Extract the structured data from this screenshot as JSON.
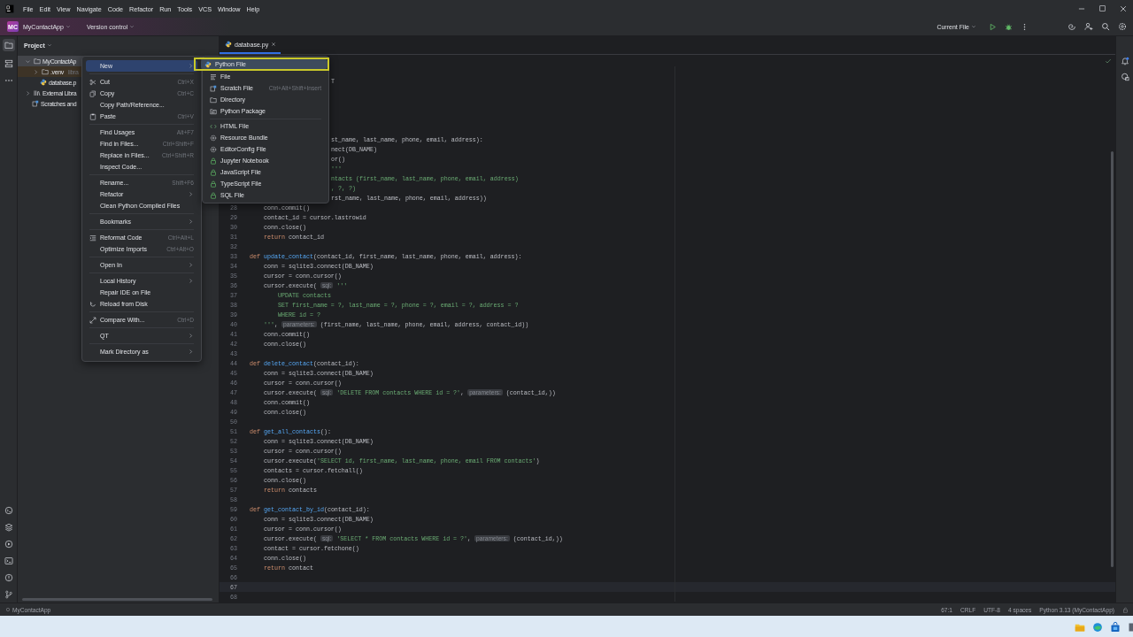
{
  "menu_bar": [
    "File",
    "Edit",
    "View",
    "Navigate",
    "Code",
    "Refactor",
    "Run",
    "Tools",
    "VCS",
    "Window",
    "Help"
  ],
  "toolbar": {
    "project_badge": "MC",
    "project": "MyContactApp",
    "vcs": "Version control",
    "run_config": "Current File"
  },
  "project_panel": {
    "title": "Project",
    "tree": [
      {
        "label": "MyContactAp",
        "kind": "folder",
        "expanded": true,
        "selected": true,
        "excluded": false,
        "children": [
          {
            "label": ".venv",
            "hint": "libra",
            "kind": "folder",
            "expanded": false,
            "selected": false,
            "excluded": true
          },
          {
            "label": "database.p",
            "kind": "python-file",
            "selected": false,
            "excluded": false
          }
        ]
      },
      {
        "label": "External Libra",
        "kind": "libraries",
        "expanded": false,
        "selected": false,
        "excluded": false
      },
      {
        "label": "Scratches and",
        "kind": "scratches",
        "selected": false,
        "excluded": false
      }
    ]
  },
  "editor": {
    "tabs": [
      {
        "label": "database.py",
        "selected": true
      }
    ],
    "lines": [
      {
        "current": false
      },
      {
        "current": false,
        "tokens": [
          {
            "kind": "plain",
            "text": "T"
          }
        ]
      },
      {
        "current": false
      },
      {
        "current": false
      },
      {
        "current": false
      },
      {
        "current": false
      },
      {
        "current": false
      },
      {
        "current": false,
        "tokens": [
          {
            "kind": "plain",
            "text": "st_name, last_name, phone, email, address):"
          }
        ]
      },
      {
        "current": false,
        "tokens": [
          {
            "kind": "plain",
            "text": "nect(DB_NAME)"
          }
        ]
      },
      {
        "current": false,
        "tokens": [
          {
            "kind": "plain",
            "text": "or()"
          }
        ]
      },
      {
        "current": false,
        "tokens": [
          {
            "kind": "string",
            "text": "'''"
          }
        ]
      },
      {
        "current": false,
        "tokens": [
          {
            "kind": "string",
            "text": "ntacts (first_name, last_name, phone, email, address)"
          }
        ]
      },
      {
        "current": false,
        "tokens": [
          {
            "kind": "string",
            "text": ", ?, ?)"
          }
        ]
      },
      {
        "current": false,
        "tokens": [
          {
            "kind": "plain",
            "text": "rst_name, last_name, phone, email, address))"
          }
        ]
      },
      {
        "number": "28",
        "current": false,
        "tokens": [
          {
            "kind": "plain",
            "text": "    conn.commit()"
          }
        ]
      },
      {
        "number": "29",
        "current": false,
        "tokens": [
          {
            "kind": "plain",
            "text": "    contact_id = cursor.lastrowid"
          }
        ]
      },
      {
        "number": "30",
        "current": false,
        "tokens": [
          {
            "kind": "plain",
            "text": "    conn.close()"
          }
        ]
      },
      {
        "number": "31",
        "current": false,
        "tokens": [
          {
            "kind": "keyword",
            "text": "    return"
          },
          {
            "kind": "plain",
            "text": " contact_id"
          }
        ]
      },
      {
        "number": "32",
        "current": false
      },
      {
        "number": "33",
        "current": false,
        "tokens": [
          {
            "kind": "keyword",
            "text": "def "
          },
          {
            "kind": "function",
            "text": "update_contact"
          },
          {
            "kind": "plain",
            "text": "(contact_id, first_name, last_name, phone, email, address):"
          }
        ]
      },
      {
        "number": "34",
        "current": false,
        "tokens": [
          {
            "kind": "plain",
            "text": "    conn = sqlite3.connect(DB_NAME)"
          }
        ]
      },
      {
        "number": "35",
        "current": false,
        "tokens": [
          {
            "kind": "plain",
            "text": "    cursor = conn.cursor()"
          }
        ]
      },
      {
        "number": "36",
        "current": false,
        "tokens": [
          {
            "kind": "plain",
            "text": "    cursor.execute( "
          },
          {
            "kind": "hint",
            "text": "sql:"
          },
          {
            "kind": "string",
            "text": " '''"
          }
        ]
      },
      {
        "number": "37",
        "current": false,
        "tokens": [
          {
            "kind": "string",
            "text": "        UPDATE contacts"
          }
        ]
      },
      {
        "number": "38",
        "current": false,
        "tokens": [
          {
            "kind": "string",
            "text": "        SET first_name = ?, last_name = ?, phone = ?, email = ?, address = ?"
          }
        ]
      },
      {
        "number": "39",
        "current": false,
        "tokens": [
          {
            "kind": "string",
            "text": "        WHERE id = ?"
          }
        ]
      },
      {
        "number": "40",
        "current": false,
        "tokens": [
          {
            "kind": "string",
            "text": "    '''"
          },
          {
            "kind": "plain",
            "text": ", "
          },
          {
            "kind": "hint",
            "text": "parameters:"
          },
          {
            "kind": "plain",
            "text": " (first_name, last_name, phone, email, address, contact_id))"
          }
        ]
      },
      {
        "number": "41",
        "current": false,
        "tokens": [
          {
            "kind": "plain",
            "text": "    conn.commit()"
          }
        ]
      },
      {
        "number": "42",
        "current": false,
        "tokens": [
          {
            "kind": "plain",
            "text": "    conn.close()"
          }
        ]
      },
      {
        "number": "43",
        "current": false
      },
      {
        "number": "44",
        "current": false,
        "tokens": [
          {
            "kind": "keyword",
            "text": "def "
          },
          {
            "kind": "function",
            "text": "delete_contact"
          },
          {
            "kind": "plain",
            "text": "(contact_id):"
          }
        ]
      },
      {
        "number": "45",
        "current": false,
        "tokens": [
          {
            "kind": "plain",
            "text": "    conn = sqlite3.connect(DB_NAME)"
          }
        ]
      },
      {
        "number": "46",
        "current": false,
        "tokens": [
          {
            "kind": "plain",
            "text": "    cursor = conn.cursor()"
          }
        ]
      },
      {
        "number": "47",
        "current": false,
        "tokens": [
          {
            "kind": "plain",
            "text": "    cursor.execute( "
          },
          {
            "kind": "hint",
            "text": "sql:"
          },
          {
            "kind": "string",
            "text": " 'DELETE FROM contacts WHERE id = ?'"
          },
          {
            "kind": "plain",
            "text": ", "
          },
          {
            "kind": "hint",
            "text": "parameters:"
          },
          {
            "kind": "plain",
            "text": " (contact_id,))"
          }
        ]
      },
      {
        "number": "48",
        "current": false,
        "tokens": [
          {
            "kind": "plain",
            "text": "    conn.commit()"
          }
        ]
      },
      {
        "number": "49",
        "current": false,
        "tokens": [
          {
            "kind": "plain",
            "text": "    conn.close()"
          }
        ]
      },
      {
        "number": "50",
        "current": false
      },
      {
        "number": "51",
        "current": false,
        "tokens": [
          {
            "kind": "keyword",
            "text": "def "
          },
          {
            "kind": "function",
            "text": "get_all_contacts"
          },
          {
            "kind": "plain",
            "text": "():"
          }
        ]
      },
      {
        "number": "52",
        "current": false,
        "tokens": [
          {
            "kind": "plain",
            "text": "    conn = sqlite3.connect(DB_NAME)"
          }
        ]
      },
      {
        "number": "53",
        "current": false,
        "tokens": [
          {
            "kind": "plain",
            "text": "    cursor = conn.cursor()"
          }
        ]
      },
      {
        "number": "54",
        "current": false,
        "tokens": [
          {
            "kind": "plain",
            "text": "    cursor.execute("
          },
          {
            "kind": "string",
            "text": "'SELECT id, first_name, last_name, phone, email FROM contacts'"
          },
          {
            "kind": "plain",
            "text": ")"
          }
        ]
      },
      {
        "number": "55",
        "current": false,
        "tokens": [
          {
            "kind": "plain",
            "text": "    contacts = cursor.fetchall()"
          }
        ]
      },
      {
        "number": "56",
        "current": false,
        "tokens": [
          {
            "kind": "plain",
            "text": "    conn.close()"
          }
        ]
      },
      {
        "number": "57",
        "current": false,
        "tokens": [
          {
            "kind": "keyword",
            "text": "    return"
          },
          {
            "kind": "plain",
            "text": " contacts"
          }
        ]
      },
      {
        "number": "58",
        "current": false
      },
      {
        "number": "59",
        "current": false,
        "tokens": [
          {
            "kind": "keyword",
            "text": "def "
          },
          {
            "kind": "function",
            "text": "get_contact_by_id"
          },
          {
            "kind": "plain",
            "text": "(contact_id):"
          }
        ]
      },
      {
        "number": "60",
        "current": false,
        "tokens": [
          {
            "kind": "plain",
            "text": "    conn = sqlite3.connect(DB_NAME)"
          }
        ]
      },
      {
        "number": "61",
        "current": false,
        "tokens": [
          {
            "kind": "plain",
            "text": "    cursor = conn.cursor()"
          }
        ]
      },
      {
        "number": "62",
        "current": false,
        "tokens": [
          {
            "kind": "plain",
            "text": "    cursor.execute( "
          },
          {
            "kind": "hint",
            "text": "sql:"
          },
          {
            "kind": "string",
            "text": " 'SELECT * FROM contacts WHERE id = ?'"
          },
          {
            "kind": "plain",
            "text": ", "
          },
          {
            "kind": "hint",
            "text": "parameters:"
          },
          {
            "kind": "plain",
            "text": " (contact_id,))"
          }
        ]
      },
      {
        "number": "63",
        "current": false,
        "tokens": [
          {
            "kind": "plain",
            "text": "    contact = cursor.fetchone()"
          }
        ]
      },
      {
        "number": "64",
        "current": false,
        "tokens": [
          {
            "kind": "plain",
            "text": "    conn.close()"
          }
        ]
      },
      {
        "number": "65",
        "current": false,
        "tokens": [
          {
            "kind": "keyword",
            "text": "    return"
          },
          {
            "kind": "plain",
            "text": " contact"
          }
        ]
      },
      {
        "number": "66",
        "current": false
      },
      {
        "number": "67",
        "current": true
      },
      {
        "number": "68",
        "current": false
      }
    ]
  },
  "context_menu": {
    "items": [
      {
        "kind": "item",
        "label": "New",
        "selected": true,
        "submenu": true
      },
      {
        "kind": "separator"
      },
      {
        "kind": "item",
        "label": "Cut",
        "shortcut": "Ctrl+X",
        "selected": false,
        "submenu": false
      },
      {
        "kind": "item",
        "label": "Copy",
        "shortcut": "Ctrl+C",
        "selected": false,
        "submenu": false
      },
      {
        "kind": "item",
        "label": "Copy Path/Reference...",
        "selected": false,
        "submenu": false
      },
      {
        "kind": "item",
        "label": "Paste",
        "shortcut": "Ctrl+V",
        "selected": false,
        "submenu": false
      },
      {
        "kind": "separator"
      },
      {
        "kind": "item",
        "label": "Find Usages",
        "shortcut": "Alt+F7",
        "selected": false,
        "submenu": false
      },
      {
        "kind": "item",
        "label": "Find in Files...",
        "shortcut": "Ctrl+Shift+F",
        "selected": false,
        "submenu": false
      },
      {
        "kind": "item",
        "label": "Replace in Files...",
        "shortcut": "Ctrl+Shift+R",
        "selected": false,
        "submenu": false
      },
      {
        "kind": "item",
        "label": "Inspect Code...",
        "selected": false,
        "submenu": false
      },
      {
        "kind": "separator"
      },
      {
        "kind": "item",
        "label": "Rename...",
        "shortcut": "Shift+F6",
        "selected": false,
        "submenu": false
      },
      {
        "kind": "item",
        "label": "Refactor",
        "selected": false,
        "submenu": true
      },
      {
        "kind": "item",
        "label": "Clean Python Compiled Files",
        "selected": false,
        "submenu": false
      },
      {
        "kind": "separator"
      },
      {
        "kind": "item",
        "label": "Bookmarks",
        "selected": false,
        "submenu": true
      },
      {
        "kind": "separator"
      },
      {
        "kind": "item",
        "label": "Reformat Code",
        "shortcut": "Ctrl+Alt+L",
        "selected": false,
        "submenu": false
      },
      {
        "kind": "item",
        "label": "Optimize Imports",
        "shortcut": "Ctrl+Alt+O",
        "selected": false,
        "submenu": false
      },
      {
        "kind": "separator"
      },
      {
        "kind": "item",
        "label": "Open In",
        "selected": false,
        "submenu": true
      },
      {
        "kind": "separator"
      },
      {
        "kind": "item",
        "label": "Local History",
        "selected": false,
        "submenu": true
      },
      {
        "kind": "item",
        "label": "Repair IDE on File",
        "selected": false,
        "submenu": false
      },
      {
        "kind": "item",
        "label": "Reload from Disk",
        "selected": false,
        "submenu": false
      },
      {
        "kind": "separator"
      },
      {
        "kind": "item",
        "label": "Compare With...",
        "shortcut": "Ctrl+D",
        "selected": false,
        "submenu": false
      },
      {
        "kind": "separator"
      },
      {
        "kind": "item",
        "label": "QT",
        "selected": false,
        "submenu": true
      },
      {
        "kind": "separator"
      },
      {
        "kind": "item",
        "label": "Mark Directory as",
        "selected": false,
        "submenu": true
      }
    ]
  },
  "new_submenu": {
    "items": [
      {
        "kind": "item",
        "label": "Python File",
        "selected": true,
        "outlined": true
      },
      {
        "kind": "item",
        "label": "File",
        "selected": false,
        "outlined": false
      },
      {
        "kind": "item",
        "label": "Scratch File",
        "shortcut": "Ctrl+Alt+Shift+Insert",
        "selected": false,
        "outlined": false
      },
      {
        "kind": "item",
        "label": "Directory",
        "selected": false,
        "outlined": false
      },
      {
        "kind": "item",
        "label": "Python Package",
        "selected": false,
        "outlined": false
      },
      {
        "kind": "separator"
      },
      {
        "kind": "item",
        "label": "HTML File",
        "selected": false,
        "outlined": false
      },
      {
        "kind": "item",
        "label": "Resource Bundle",
        "selected": false,
        "outlined": false
      },
      {
        "kind": "item",
        "label": "EditorConfig File",
        "selected": false,
        "outlined": false
      },
      {
        "kind": "item",
        "label": "Jupyter Notebook",
        "selected": false,
        "outlined": false
      },
      {
        "kind": "item",
        "label": "JavaScript File",
        "selected": false,
        "outlined": false
      },
      {
        "kind": "item",
        "label": "TypeScript File",
        "selected": false,
        "outlined": false
      },
      {
        "kind": "item",
        "label": "SQL File",
        "selected": false,
        "outlined": false
      }
    ]
  },
  "status_bar": {
    "project": "MyContactApp",
    "items": [
      "67:1",
      "CRLF",
      "UTF-8",
      "4 spaces",
      "Python 3.13 (MyContactApp)"
    ]
  }
}
